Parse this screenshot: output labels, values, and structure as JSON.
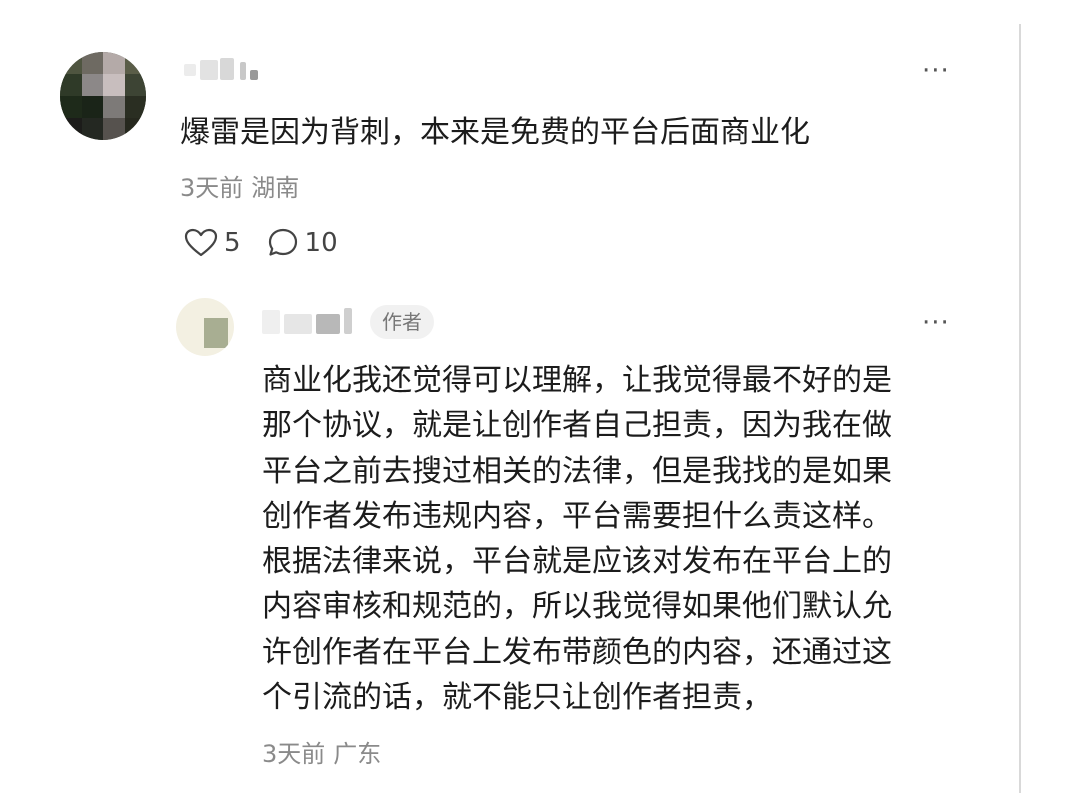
{
  "main_comment": {
    "text": "爆雷是因为背刺，本来是免费的平台后面商业化",
    "time": "3天前",
    "location": "湖南",
    "like_count": "5",
    "reply_count": "10",
    "more_label": "···"
  },
  "reply": {
    "badge": "作者",
    "more_label": "···",
    "lines": [
      "商业化我还觉得可以理解，让我觉得最不好的是",
      "那个协议，就是让创作者自己担责，因为我在做",
      "平台之前去搜过相关的法律，但是我找的是如果",
      "创作者发布违规内容，平台需要担什么责这样。",
      "根据法律来说，平台就是应该对发布在平台上的",
      "内容审核和规范的，所以我觉得如果他们默认允",
      "许创作者在平台上发布带颜色的内容，还通过这",
      "个引流的话，就不能只让创作者担责，"
    ],
    "time": "3天前",
    "location": "广东"
  },
  "icons": {
    "like": "heart-outline-icon",
    "reply": "chat-bubble-icon",
    "more": "more-dots-icon"
  }
}
